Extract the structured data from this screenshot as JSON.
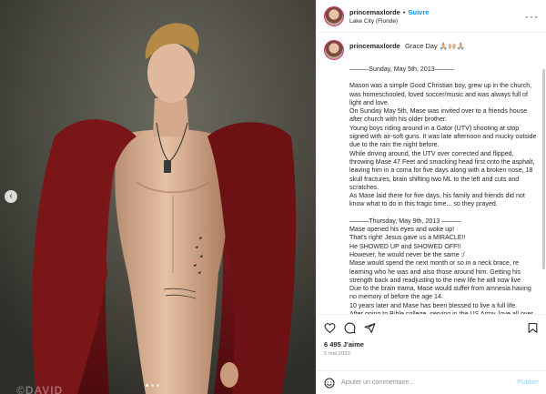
{
  "header": {
    "username": "princemaxlorde",
    "separator": "•",
    "follow_label": "Suivre",
    "location": "Lake City (Floride)",
    "more_icon": "more-horizontal-icon"
  },
  "caption": {
    "username": "princemaxlorde",
    "title": "Grace Day 🙏🏼🙌🏼🙏🏼",
    "lines": [
      "———Sunday, May 5th, 2013———",
      "",
      "Mason was a simple Good Christian boy, grew up in the church, was homeschooled, loved soccer/music and was always full of light and love.",
      "On Sunday May 5th, Mase was invited over to a friends house after church with his older brother.",
      "Young boys riding around in a Gator (UTV) shooting at stop signed with air-soft guns. It was late afternoon and mucky outside due to the rain the night before.",
      "While driving around, the UTV over corrected and flipped, throwing Mase 47 Feet and smacking head first onto the asphalt, leaving him in a coma for five days along with a broken nose, 18 skull fractures, brain shifting two ML to the left and cuts and scratches.",
      "As Mase laid there for five days, his family and friends did not know what to do in this tragic time... so they prayed.",
      "",
      "———Thursday, May 9th, 2013 ———",
      "Mase opened his eyes and woke up!",
      "That's right! Jesus gave us a MIRACLE!!",
      "He SHOWED UP and SHOWED OFF!!",
      "However, he would never be the same :/",
      "Mase would spend the next month or so in a neck brace, re learning who he was and also those around him. Getting his strength back and readjusting to the new life he will now live",
      "Due to the brain trama, Mase would suffer from amnesia having no memory of before the age 14.",
      "10 years later and Mase has been blessed to live a full life.",
      "After going to Bible college, serving in the US Army, love all over the country (literally) and continue to grow and learn about himself."
    ]
  },
  "actions": {
    "icons": [
      "heart-icon",
      "comment-icon",
      "share-icon",
      "bookmark-icon"
    ],
    "likes_count": "6 495",
    "likes_label": "J'aime",
    "date": "5 mai 2023"
  },
  "comment": {
    "placeholder": "Ajouter un commentaire...",
    "publish_label": "Publier",
    "emoji_icon": "emoji-icon"
  },
  "photo": {
    "watermark": "©DAVID",
    "prev_icon": "chevron-left-icon",
    "slides_total": 3,
    "slide_active": 1
  },
  "colors": {
    "link_blue": "#0095f6",
    "publish_disabled": "#b2dffc",
    "muted": "#8e8e8e",
    "drape_red": "#7a1518",
    "backdrop": "#4b4a42"
  }
}
